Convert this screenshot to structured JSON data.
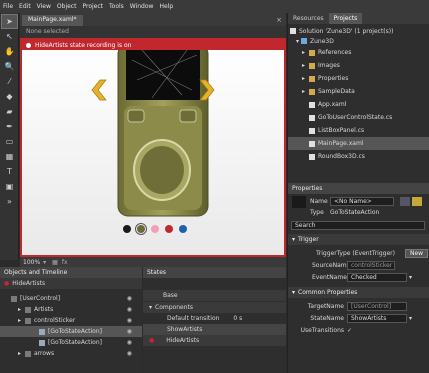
{
  "menu": [
    "File",
    "Edit",
    "View",
    "Object",
    "Project",
    "Tools",
    "Window",
    "Help"
  ],
  "document": {
    "tab": "MainPage.xaml*",
    "close": "×",
    "selection": "None selected",
    "recording": "HideArtists state recording is on",
    "zoom": "100%"
  },
  "swatches": [
    "#1a1a1a",
    "#6a6a3a",
    "#f2a0b8",
    "#c0282e",
    "#1e5fb0"
  ],
  "objects": {
    "header": "Objects and Timeline",
    "state": "HideArtists",
    "items": [
      {
        "label": "[UserControl]",
        "indent": 0
      },
      {
        "label": "Artists",
        "indent": 1
      },
      {
        "label": "controlSticker",
        "indent": 1
      },
      {
        "label": "[GoToStateAction]",
        "indent": 2,
        "selected": true
      },
      {
        "label": "[GoToStateAction]",
        "indent": 2
      },
      {
        "label": "arrows",
        "indent": 1
      }
    ]
  },
  "states": {
    "header": "States",
    "base": "Base",
    "group": "Components",
    "default_transition": "Default transition",
    "time": "0 s",
    "items": [
      {
        "label": "ShowArtists"
      },
      {
        "label": "HideArtists",
        "recording": true
      }
    ]
  },
  "resources": {
    "tabs": [
      "Resources",
      "Projects"
    ],
    "solution": "Solution 'Zune3D' (1 project(s))",
    "project": "Zune3D",
    "items": [
      {
        "label": "References",
        "kind": "folder"
      },
      {
        "label": "Images",
        "kind": "folder"
      },
      {
        "label": "Properties",
        "kind": "folder"
      },
      {
        "label": "SampleData",
        "kind": "folder"
      },
      {
        "label": "App.xaml",
        "kind": "file"
      },
      {
        "label": "GoToUserControlState.cs",
        "kind": "file"
      },
      {
        "label": "ListBoxPanel.cs",
        "kind": "file"
      },
      {
        "label": "MainPage.xaml",
        "kind": "file",
        "selected": true
      },
      {
        "label": "RoundBox3D.cs",
        "kind": "file"
      }
    ]
  },
  "properties": {
    "header": "Properties",
    "name_label": "Name",
    "name_value": "<No Name>",
    "type_label": "Type",
    "type_value": "GoToStateAction",
    "search": "Search",
    "trigger_section": "Trigger",
    "trigger_type": "TriggerType (EventTrigger)",
    "new": "New",
    "source_label": "SourceName",
    "source_value": "controlSticker",
    "event_label": "EventName",
    "event_value": "Checked",
    "common_section": "Common Properties",
    "target_label": "TargetName",
    "target_value": "[UserControl]",
    "state_label": "StateName",
    "state_value": "ShowArtists",
    "transitions_label": "UseTransitions",
    "transitions_value": "✓"
  }
}
